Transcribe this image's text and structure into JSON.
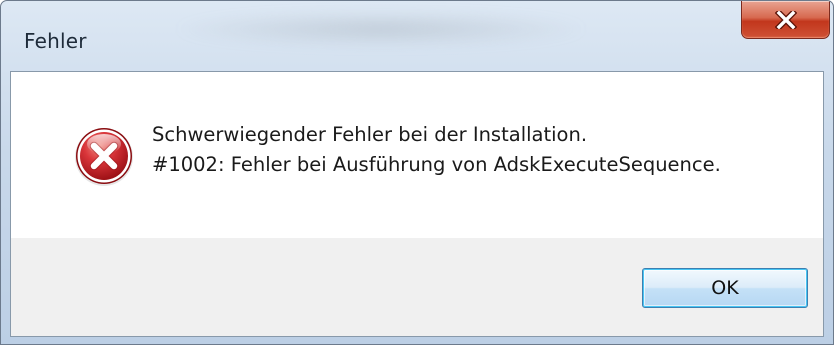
{
  "window": {
    "title": "Fehler"
  },
  "titlebar": {
    "close_icon": "close-icon"
  },
  "dialog": {
    "icon": "error-icon",
    "message_line1": "Schwerwiegender Fehler bei der Installation.",
    "message_line2": "#1002: Fehler bei Ausführung von AdskExecuteSequence."
  },
  "buttons": {
    "ok_label": "OK"
  },
  "colors": {
    "close_button": "#c2361c",
    "error_icon": "#c4232a",
    "ok_button_border": "#3c7fb1"
  }
}
